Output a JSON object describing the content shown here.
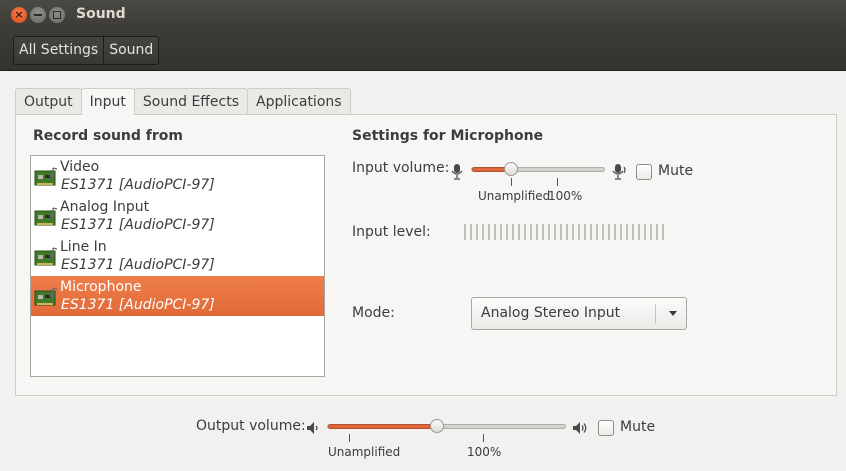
{
  "window": {
    "title": "Sound"
  },
  "toolbar": {
    "crumbs": [
      "All Settings",
      "Sound"
    ]
  },
  "tabs": [
    "Output",
    "Input",
    "Sound Effects",
    "Applications"
  ],
  "active_tab": "Input",
  "input": {
    "record_heading": "Record sound from",
    "devices": [
      {
        "name": "Video",
        "sub": "ES1371 [AudioPCI-97]"
      },
      {
        "name": "Analog Input",
        "sub": "ES1371 [AudioPCI-97]"
      },
      {
        "name": "Line In",
        "sub": "ES1371 [AudioPCI-97]"
      },
      {
        "name": "Microphone",
        "sub": "ES1371 [AudioPCI-97]"
      }
    ],
    "selected_device": "Microphone",
    "settings_heading": "Settings for Microphone",
    "volume_label": "Input volume:",
    "volume_fraction": 0.3,
    "tick_unamplified": "Unamplified",
    "tick_100": "100%",
    "mute_label": "Mute",
    "level_label": "Input level:",
    "mode_label": "Mode:",
    "mode_value": "Analog Stereo Input"
  },
  "output": {
    "volume_label": "Output volume:",
    "volume_fraction": 0.46,
    "tick_unamplified": "Unamplified",
    "tick_100": "100%",
    "mute_label": "Mute"
  },
  "colors": {
    "accent": "#e0663b",
    "selection": "#ef7d4c",
    "titlebar": "#3c3b37"
  }
}
